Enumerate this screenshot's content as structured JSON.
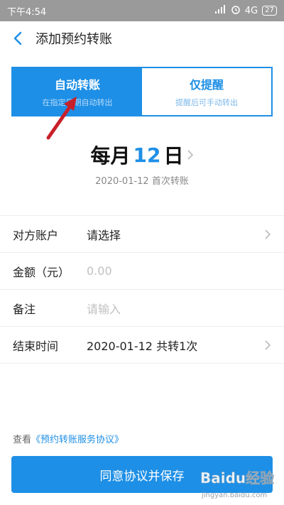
{
  "status": {
    "time": "下午4:54",
    "network": "4G",
    "battery": "27"
  },
  "header": {
    "title": "添加预约转账"
  },
  "tabs": [
    {
      "label": "自动转账",
      "sub": "在指定日期自动转出"
    },
    {
      "label": "仅提醒",
      "sub": "提醒后可手动转出"
    }
  ],
  "schedule": {
    "prefix": "每月",
    "day": "12",
    "suffix": "日",
    "first_transfer": "2020-01-12 首次转账"
  },
  "form": {
    "rows": [
      {
        "label": "对方账户",
        "value": "请选择"
      },
      {
        "label": "金额（元）",
        "placeholder": "0.00"
      },
      {
        "label": "备注",
        "placeholder": "请输入"
      },
      {
        "label": "结束时间",
        "value": "2020-01-12 共转1次"
      }
    ]
  },
  "agreement": {
    "prefix": "查看",
    "link": "《预约转账服务协议》"
  },
  "cta": {
    "label": "同意协议并保存"
  },
  "watermark": {
    "text": "Baidu经验",
    "sub": "jingyan.baidu.com"
  },
  "colors": {
    "accent": "#1e8fe6",
    "annotation_arrow": "#c8202a"
  }
}
